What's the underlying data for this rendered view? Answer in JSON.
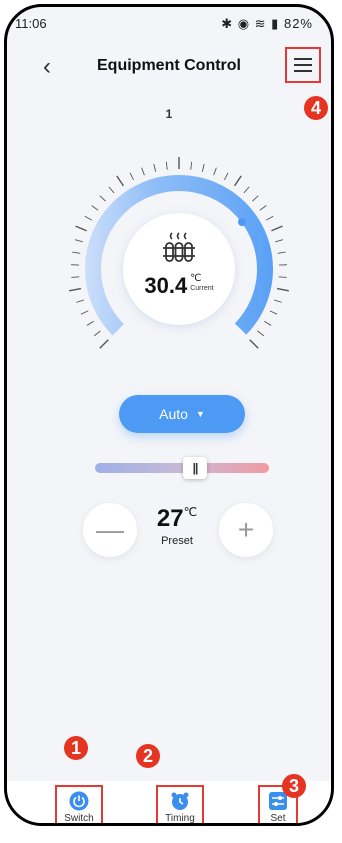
{
  "status_bar": {
    "time": "11:06",
    "right": "82%"
  },
  "header": {
    "title": "Equipment Control"
  },
  "device": {
    "name": "1"
  },
  "thermostat": {
    "current_temp": "30.4",
    "unit": "℃",
    "current_label": "Current"
  },
  "mode": {
    "label": "Auto"
  },
  "preset": {
    "value": "27",
    "unit": "℃",
    "label": "Preset",
    "minus": "—",
    "plus": "+"
  },
  "tabs": [
    {
      "label": "Switch",
      "icon": "power-icon"
    },
    {
      "label": "Timing",
      "icon": "alarm-clock-icon"
    },
    {
      "label": "Set",
      "icon": "settings-sliders-icon"
    }
  ],
  "annotations": [
    "1",
    "2",
    "3",
    "4"
  ],
  "colors": {
    "accent": "#4d9af5",
    "badge": "#e53422",
    "highlight_border": "#e53935"
  }
}
